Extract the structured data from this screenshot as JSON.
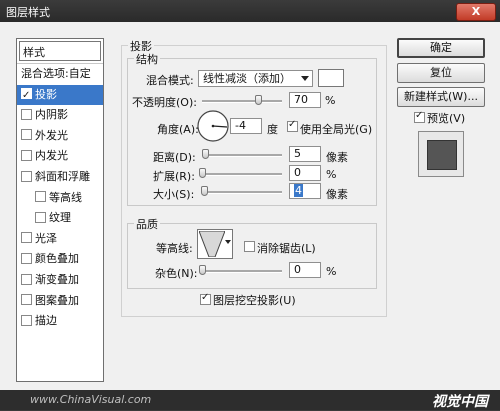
{
  "window": {
    "title": "图层样式",
    "close_label": "X"
  },
  "styles": {
    "header": "样式",
    "items": [
      {
        "label": "混合选项:自定",
        "checkbox": false,
        "checked": false,
        "indent": false
      },
      {
        "label": "投影",
        "checkbox": true,
        "checked": true,
        "indent": false,
        "selected": true
      },
      {
        "label": "内阴影",
        "checkbox": true,
        "checked": false,
        "indent": false
      },
      {
        "label": "外发光",
        "checkbox": true,
        "checked": false,
        "indent": false
      },
      {
        "label": "内发光",
        "checkbox": true,
        "checked": false,
        "indent": false
      },
      {
        "label": "斜面和浮雕",
        "checkbox": true,
        "checked": false,
        "indent": false
      },
      {
        "label": "等高线",
        "checkbox": true,
        "checked": false,
        "indent": true
      },
      {
        "label": "纹理",
        "checkbox": true,
        "checked": false,
        "indent": true
      },
      {
        "label": "光泽",
        "checkbox": true,
        "checked": false,
        "indent": false
      },
      {
        "label": "颜色叠加",
        "checkbox": true,
        "checked": false,
        "indent": false
      },
      {
        "label": "渐变叠加",
        "checkbox": true,
        "checked": false,
        "indent": false
      },
      {
        "label": "图案叠加",
        "checkbox": true,
        "checked": false,
        "indent": false
      },
      {
        "label": "描边",
        "checkbox": true,
        "checked": false,
        "indent": false
      }
    ]
  },
  "drop_shadow": {
    "section_title": "投影",
    "structure": {
      "title": "结构",
      "blend_mode_label": "混合模式:",
      "blend_mode_value": "线性减淡（添加）",
      "opacity_label": "不透明度(O):",
      "opacity_value": "70",
      "opacity_unit": "%",
      "opacity_level": 0.7,
      "angle_label": "角度(A):",
      "angle_value": "-4",
      "angle_unit": "度",
      "global_light_label": "使用全局光(G)",
      "global_light_checked": true,
      "distance_label": "距离(D):",
      "distance_value": "5",
      "distance_unit": "像素",
      "spread_label": "扩展(R):",
      "spread_value": "0",
      "spread_unit": "%",
      "size_label": "大小(S):",
      "size_value": "4",
      "size_unit": "像素"
    },
    "quality": {
      "title": "品质",
      "contour_label": "等高线:",
      "anti_alias_label": "消除锯齿(L)",
      "anti_alias_checked": false,
      "noise_label": "杂色(N):",
      "noise_value": "0",
      "noise_unit": "%"
    },
    "knockout_label": "图层挖空投影(U)",
    "knockout_checked": true
  },
  "buttons": {
    "ok": "确定",
    "reset": "复位",
    "new_style": "新建样式(W)...",
    "preview_label": "预览(V)",
    "preview_checked": true
  },
  "footer": {
    "watermark": "www.ChinaVisual.com",
    "logo": "视觉中国"
  },
  "colors": {
    "selection": "#3a78c9",
    "preview_swatch": "#555555",
    "size_highlight": "#3a78c9"
  }
}
